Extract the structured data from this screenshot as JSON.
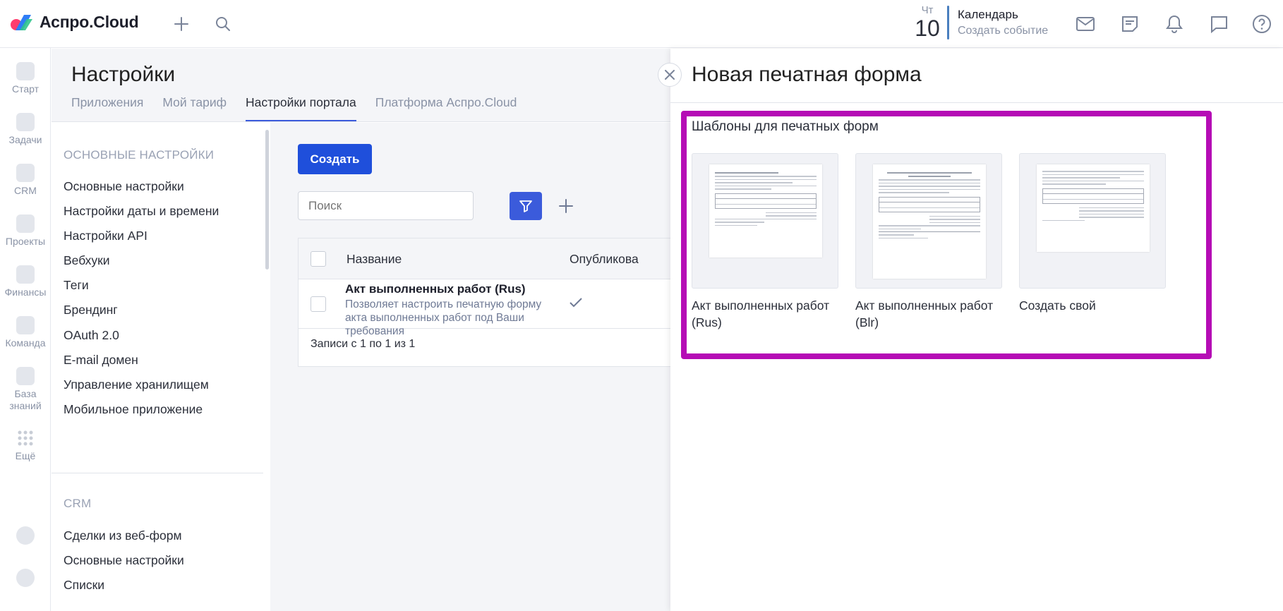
{
  "app": {
    "logo_text": "Аспро.Cloud"
  },
  "header": {
    "calendar": {
      "day_of_week": "Чт",
      "day": "10",
      "title": "Календарь",
      "subtitle": "Создать событие"
    }
  },
  "rail": [
    {
      "label": "Старт",
      "icon": "heart-icon"
    },
    {
      "label": "Задачи",
      "icon": "check-icon"
    },
    {
      "label": "CRM",
      "icon": "funnel-icon"
    },
    {
      "label": "Проекты",
      "icon": "projects-icon"
    },
    {
      "label": "Финансы",
      "icon": "finance-icon"
    },
    {
      "label": "Команда",
      "icon": "team-icon"
    },
    {
      "label": "База знаний",
      "icon": "knowledge-icon"
    },
    {
      "label": "Ещё",
      "icon": "grid-dots-icon"
    }
  ],
  "settings": {
    "title": "Настройки",
    "tabs": [
      {
        "label": "Приложения",
        "active": false
      },
      {
        "label": "Мой тариф",
        "active": false
      },
      {
        "label": "Настройки портала",
        "active": true
      },
      {
        "label": "Платформа Аспро.Cloud",
        "active": false
      }
    ],
    "menu_section_1": "ОСНОВНЫЕ НАСТРОЙКИ",
    "menu_items_1": [
      "Основные настройки",
      "Настройки даты и времени",
      "Настройки API",
      "Вебхуки",
      "Теги",
      "Брендинг",
      "OAuth 2.0",
      "E-mail домен",
      "Управление хранилищем",
      "Мобильное приложение"
    ],
    "menu_section_2": "CRM",
    "menu_items_2": [
      "Сделки из веб-форм",
      "Основные настройки",
      "Списки"
    ]
  },
  "content": {
    "create_button": "Создать",
    "search_placeholder": "Поиск",
    "table": {
      "col_name": "Название",
      "col_published": "Опубликова",
      "rows": [
        {
          "title": "Акт выполненных работ (Rus)",
          "description": "Позволяет настроить печатную форму акта выполненных работ под Ваши требования",
          "published": true
        }
      ],
      "footer": "Записи с 1 по 1 из 1"
    }
  },
  "drawer": {
    "title": "Новая печатная форма",
    "templates_heading": "Шаблоны для печатных форм",
    "templates": [
      {
        "label": "Акт выполненных работ (Rus)"
      },
      {
        "label": "Акт выполненных работ (Blr)"
      },
      {
        "label": "Создать свой"
      }
    ]
  },
  "colors": {
    "primary": "#1f4fdb",
    "highlight": "#b50cb5",
    "calendar_bar": "#4a7fbf"
  }
}
